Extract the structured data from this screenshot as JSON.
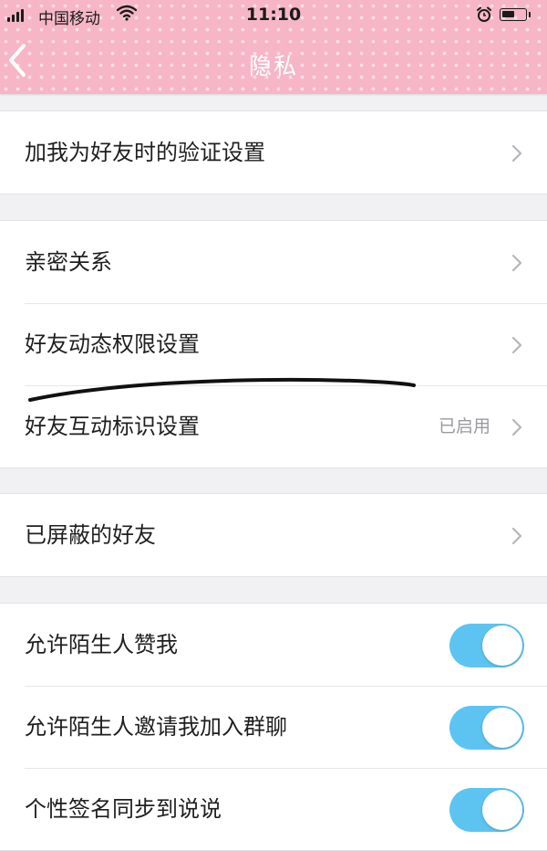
{
  "status_bar": {
    "carrier": "中国移动",
    "time": "11:10"
  },
  "header": {
    "title": "隐私",
    "background_color": "#f6b6c6"
  },
  "groups": [
    {
      "rows": [
        {
          "label": "加我为好友时的验证设置"
        }
      ]
    },
    {
      "rows": [
        {
          "label": "亲密关系"
        },
        {
          "label": "好友动态权限设置"
        },
        {
          "label": "好友互动标识设置",
          "value": "已启用"
        }
      ]
    },
    {
      "rows": [
        {
          "label": "已屏蔽的好友"
        }
      ]
    },
    {
      "rows": [
        {
          "label": "允许陌生人赞我",
          "toggle_on": true
        },
        {
          "label": "允许陌生人邀请我加入群聊",
          "toggle_on": true
        },
        {
          "label": "个性签名同步到说说",
          "toggle_on": true
        }
      ]
    }
  ],
  "colors": {
    "toggle_on": "#5dc4f2",
    "page_background": "#f1f1f3"
  }
}
